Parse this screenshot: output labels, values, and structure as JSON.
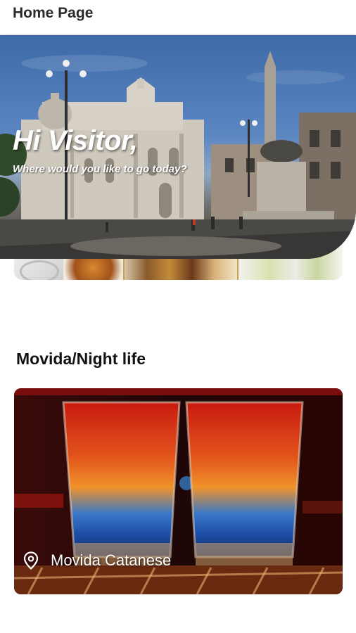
{
  "app_bar": {
    "title": "Home Page"
  },
  "hero": {
    "greeting": "Hi Visitor,",
    "question": "Where would you like to go today?"
  },
  "sections": [
    {
      "title": "Movida/Night life",
      "cards": [
        {
          "label": "Movida Catanese",
          "icon": "location-pin-icon"
        }
      ]
    }
  ]
}
